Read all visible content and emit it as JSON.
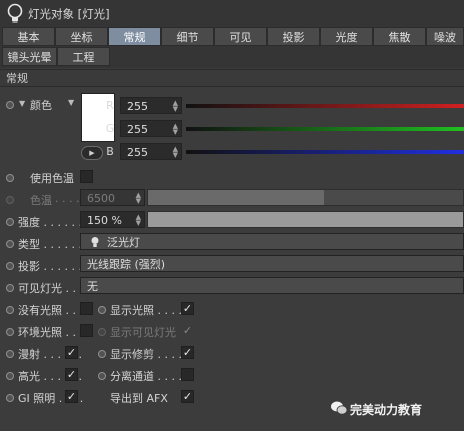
{
  "window": {
    "title": "灯光对象 [灯光]"
  },
  "tabs": [
    {
      "label": "基本",
      "active": false
    },
    {
      "label": "坐标",
      "active": false
    },
    {
      "label": "常规",
      "active": true
    },
    {
      "label": "细节",
      "active": false
    },
    {
      "label": "可见",
      "active": false
    },
    {
      "label": "投影",
      "active": false
    },
    {
      "label": "光度",
      "active": false
    },
    {
      "label": "焦散",
      "active": false
    },
    {
      "label": "噪波",
      "active": false
    },
    {
      "label": "镜头光晕",
      "active": false
    },
    {
      "label": "工程",
      "active": false
    }
  ],
  "section": {
    "title": "常规"
  },
  "color": {
    "label": "颜色",
    "swatch": "#ffffff",
    "channels": [
      {
        "letter": "R",
        "value": "255"
      },
      {
        "letter": "G",
        "value": "255"
      },
      {
        "letter": "B",
        "value": "255"
      }
    ],
    "gradients": {
      "r": "#d02020",
      "g": "#20c020",
      "b": "#2030e0"
    }
  },
  "use_temperature": {
    "label": "使用色温",
    "checked": false
  },
  "temperature": {
    "label": "色温",
    "value": "6500",
    "enabled": false,
    "level": 0.56
  },
  "intensity": {
    "label": "强度 . . . . . .",
    "value": "150 %",
    "level": 1.0
  },
  "type": {
    "label": "类型 . . . . . .",
    "value": "泛光灯"
  },
  "shadow": {
    "label": "投影 . . . . . .",
    "value": "光线跟踪 (强烈)"
  },
  "visible_light": {
    "label": "可见灯光 . . .",
    "value": "无"
  },
  "options": {
    "no_illumination": {
      "label": "没有光照 . .",
      "checked": false
    },
    "show_illumination": {
      "label": "显示光照 . . . .",
      "checked": true
    },
    "ambient": {
      "label": "环境光照 . .",
      "checked": false
    },
    "show_visible_light": {
      "label": "显示可见灯光",
      "checked": true,
      "enabled": false
    },
    "diffuse": {
      "label": "漫射 . . . . . .",
      "checked": true
    },
    "show_clipping": {
      "label": "显示修剪 . . . .",
      "checked": true
    },
    "specular": {
      "label": "高光 . . . . . .",
      "checked": true
    },
    "separate_pass": {
      "label": "分离通道 . . . .",
      "checked": false
    },
    "gi_illumination": {
      "label": "GI 照明 . . . .",
      "checked": true
    },
    "export_afx": {
      "label": "导出到 AFX",
      "checked": true
    }
  },
  "check_mark": "✓",
  "icons": {
    "light": "light-bulb-icon",
    "watermark": "wechat-icon"
  },
  "watermark": {
    "text": "完美动力教育"
  }
}
